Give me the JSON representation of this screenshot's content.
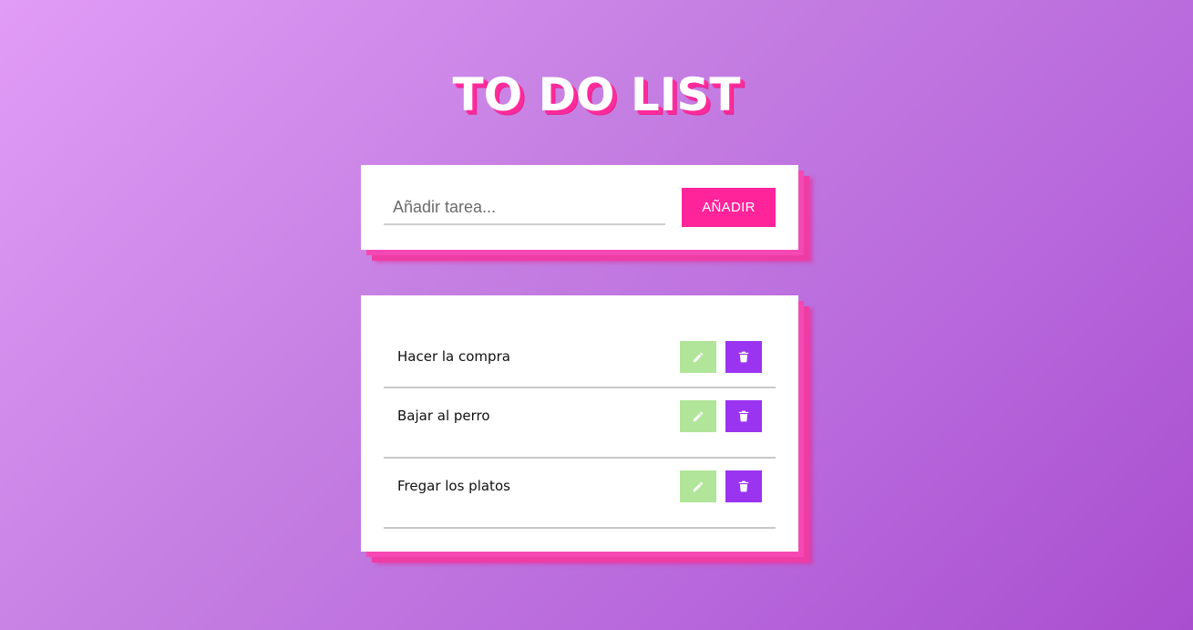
{
  "title": "TO DO LIST",
  "add_form": {
    "placeholder": "Añadir tarea...",
    "value": "",
    "button_label": "AÑADIR"
  },
  "tasks": [
    {
      "text": "Hacer la compra",
      "edit_icon": "pencil-icon",
      "delete_icon": "trash-icon"
    },
    {
      "text": "Bajar al perro",
      "edit_icon": "pencil-icon",
      "delete_icon": "trash-icon"
    },
    {
      "text": "Fregar los platos",
      "edit_icon": "pencil-icon",
      "delete_icon": "trash-icon"
    }
  ],
  "colors": {
    "accent_pink": "#ff249a",
    "edit_green": "#b0e59a",
    "delete_purple": "#9b34f0",
    "background_start": "#e19cf7",
    "background_end": "#a94ecf"
  }
}
